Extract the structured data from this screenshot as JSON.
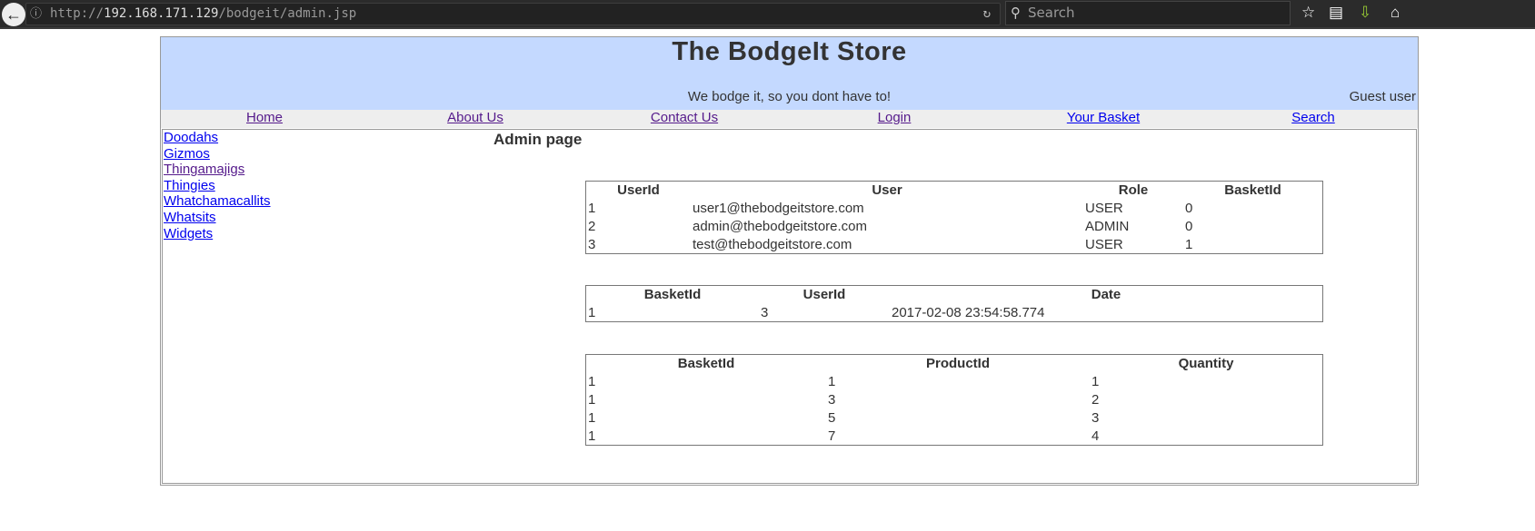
{
  "browser": {
    "url_prefix": "http://",
    "url_host": "192.168.171.129",
    "url_path": "/bodgeit/admin.jsp",
    "search_placeholder": "Search"
  },
  "header": {
    "title": "The BodgeIt Store",
    "tagline": "We bodge it, so you dont have to!",
    "user_status": "Guest user"
  },
  "nav": [
    "Home",
    "About Us",
    "Contact Us",
    "Login",
    "Your Basket",
    "Search"
  ],
  "sidebar": [
    "Doodahs",
    "Gizmos",
    "Thingamajigs",
    "Thingies",
    "Whatchamacallits",
    "Whatsits",
    "Widgets"
  ],
  "main": {
    "title": "Admin page",
    "users": {
      "headers": [
        "UserId",
        "User",
        "Role",
        "BasketId"
      ],
      "rows": [
        [
          "1",
          "user1@thebodgeitstore.com",
          "USER",
          "0"
        ],
        [
          "2",
          "admin@thebodgeitstore.com",
          "ADMIN",
          "0"
        ],
        [
          "3",
          "test@thebodgeitstore.com",
          "USER",
          "1"
        ]
      ]
    },
    "baskets": {
      "headers": [
        "BasketId",
        "UserId",
        "Date"
      ],
      "rows": [
        [
          "1",
          "3",
          "2017-02-08 23:54:58.774"
        ]
      ]
    },
    "basket_contents": {
      "headers": [
        "BasketId",
        "ProductId",
        "Quantity"
      ],
      "rows": [
        [
          "1",
          "1",
          "1"
        ],
        [
          "1",
          "3",
          "2"
        ],
        [
          "1",
          "5",
          "3"
        ],
        [
          "1",
          "7",
          "4"
        ]
      ]
    }
  }
}
